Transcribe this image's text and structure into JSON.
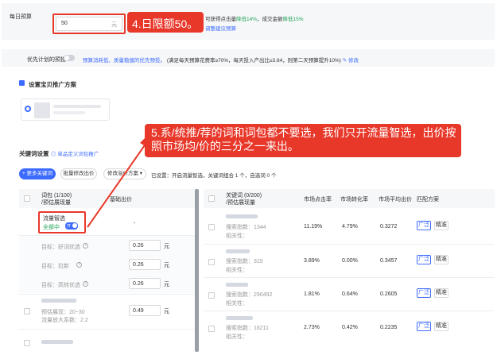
{
  "budget": {
    "label": "每日预算",
    "value": "50",
    "unit": "元",
    "hint_part1": "可获得点击量",
    "hint_down1": "降低14%",
    "hint_part2": "，成交金额",
    "hint_down2": "降低15%",
    "hint_link": "调整建议预算"
  },
  "callout4": "4.日限额50。",
  "priority": {
    "label": "优先计划的预投",
    "desc_blue": "预算消耗低、质量稳健的优先预投。",
    "desc": "(满足每天预算花费率≥70%，每天投入产出比≥3.84，则第二天预算提升10%)",
    "edit": "修改"
  },
  "item_plan": {
    "title": "设置宝贝推广方案"
  },
  "callout5": "5.系/统推/荐的词和词包都不要选，我们只开流量智选，出价按照市场均/价的三分之一来出。",
  "keywords": {
    "title": "关键词设置",
    "custom_link": "单品定义词包推广",
    "add_btn": "+ 更多关键词",
    "batch_btn": "批量修改出价",
    "plan_btn": "修改溢价方案 ▾",
    "status": "已设置：开启流量智选，关键词组合 1 个，自选词 0 个"
  },
  "left": {
    "head1": "词包 (1/100)",
    "head2": "/预估展现量",
    "head_price": "基础出价",
    "flow_title": "流量智选",
    "flow_status": "全部中",
    "flow_toggle": "开",
    "flow_price": "-",
    "sub_rows": [
      {
        "label": "目标：好词优选",
        "value": "0.26",
        "unit": "元"
      },
      {
        "label": "目标：拉新",
        "value": "0.26",
        "unit": "元"
      },
      {
        "label": "目标：高转优选",
        "value": "0.26",
        "unit": "元"
      }
    ],
    "pkg": {
      "line1": "预估展现：20~30",
      "line2": "流量放大系数：2.2",
      "value": "0.49",
      "unit": "元"
    }
  },
  "right": {
    "headers": {
      "kw1": "关键词 (0/200)",
      "kw2": "/预估展现量",
      "ctr": "市场点击率",
      "cvr": "市场转化率",
      "avg": "市场平均出价",
      "match": "匹配方案"
    },
    "rows": [
      {
        "search": "搜索指数：1344",
        "rel": "相关性：",
        "ctr": "11.19%",
        "cvr": "4.79%",
        "avg": "0.3272",
        "b1": "广泛",
        "b2": "精准"
      },
      {
        "search": "搜索指数：315",
        "rel": "相关性：",
        "ctr": "3.89%",
        "cvr": "0.00%",
        "avg": "0.3457",
        "b1": "广泛",
        "b2": "精准"
      },
      {
        "search": "搜索指数：290492",
        "rel": "相关性：",
        "ctr": "1.81%",
        "cvr": "0.64%",
        "avg": "0.2605",
        "b1": "广泛",
        "b2": "精准"
      },
      {
        "search": "搜索指数：16211",
        "rel": "相关性：",
        "ctr": "2.73%",
        "cvr": "0.42%",
        "avg": "0.2235",
        "b1": "广泛",
        "b2": "精准"
      }
    ]
  },
  "colors": {
    "accent": "#3d6bff",
    "highlight": "#e8382a",
    "down": "#22a45a"
  }
}
